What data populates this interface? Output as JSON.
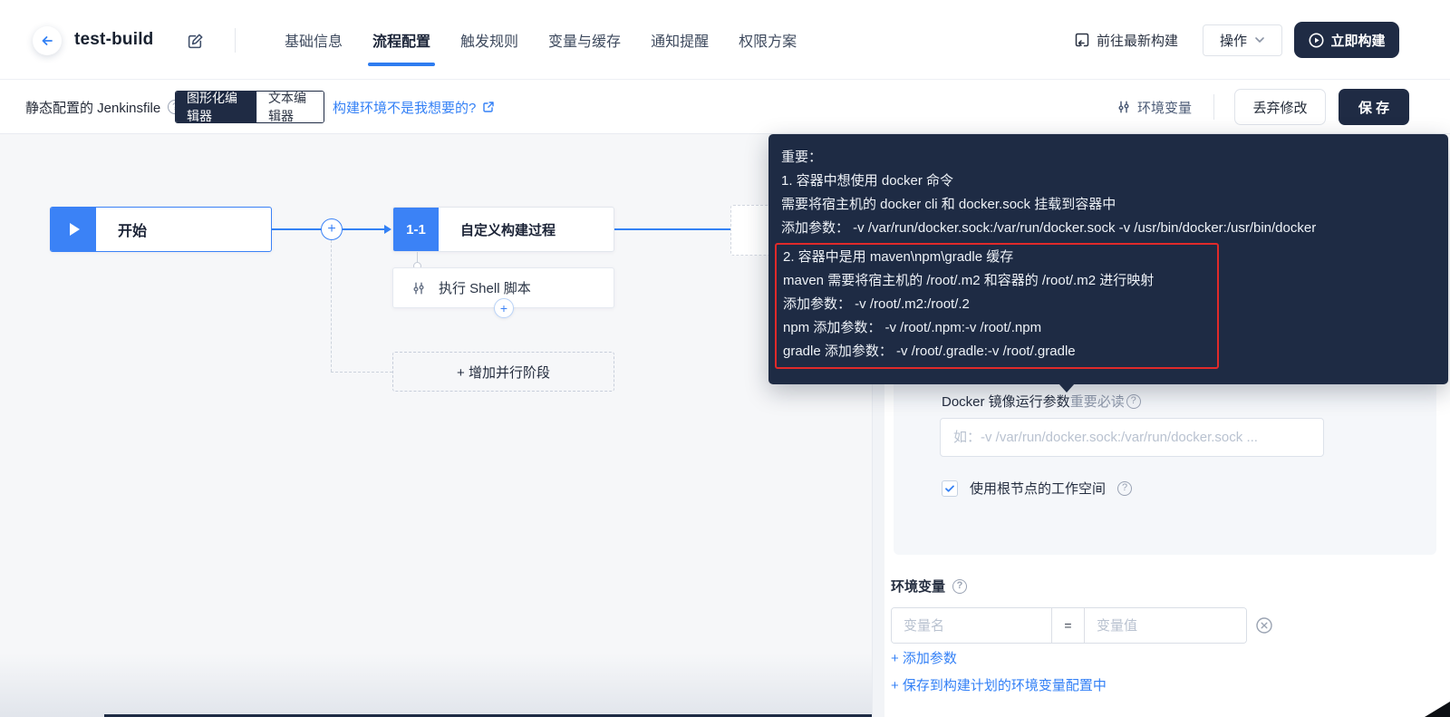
{
  "header": {
    "title": "test-build",
    "tabs": [
      {
        "label": "基础信息"
      },
      {
        "label": "流程配置"
      },
      {
        "label": "触发规则"
      },
      {
        "label": "变量与缓存"
      },
      {
        "label": "通知提醒"
      },
      {
        "label": "权限方案"
      }
    ],
    "go_latest_build": "前往最新构建",
    "actions_label": "操作",
    "build_now_label": "立即构建"
  },
  "toolbar": {
    "mode_label": "静态配置的 Jenkinsfile",
    "graphic_editor": "图形化编辑器",
    "text_editor": "文本编辑器",
    "env_not_wanted_link": "构建环境不是我想要的?",
    "env_vars_label": "环境变量",
    "discard_label": "丢弃修改",
    "save_label": "保 存"
  },
  "pipeline": {
    "start_label": "开始",
    "stage_badge": "1-1",
    "stage_title": "自定义构建过程",
    "shell_step": "执行 Shell 脚本",
    "add_parallel": "+ 增加并行阶段",
    "add_plus": "+"
  },
  "tooltip": {
    "line1": "重要：",
    "line2": "1. 容器中想使用 docker 命令",
    "line3": "需要将宿主机的 docker cli 和 docker.sock 挂载到容器中",
    "line4": "添加参数：  -v /var/run/docker.sock:/var/run/docker.sock -v /usr/bin/docker:/usr/bin/docker",
    "boxed1": "2. 容器中是用 maven\\npm\\gradle 缓存",
    "boxed2": "maven 需要将宿主机的 /root/.m2 和容器的 /root/.m2 进行映射",
    "boxed3": "添加参数：  -v /root/.m2:/root/.2",
    "boxed4": "npm 添加参数：  -v /root/.npm:-v /root/.npm",
    "boxed5": "gradle 添加参数：  -v /root/.gradle:-v /root/.gradle"
  },
  "panel": {
    "docker_label": "Docker 镜像运行参数",
    "docker_label_em": "重要必读",
    "docker_placeholder": "如：-v /var/run/docker.sock:/var/run/docker.sock ...",
    "workspace_checkbox_label": "使用根节点的工作空间",
    "env_title": "环境变量",
    "var_name_placeholder": "变量名",
    "equals": "=",
    "var_value_placeholder": "变量值",
    "add_param_link": "+ 添加参数",
    "save_to_plan_link": "+ 保存到构建计划的环境变量配置中"
  },
  "colors": {
    "accent_blue": "#3380f5",
    "dark_navy": "#1e2b44",
    "alert_red": "#e02a2a",
    "canvas_bg": "#f6f7f9"
  }
}
